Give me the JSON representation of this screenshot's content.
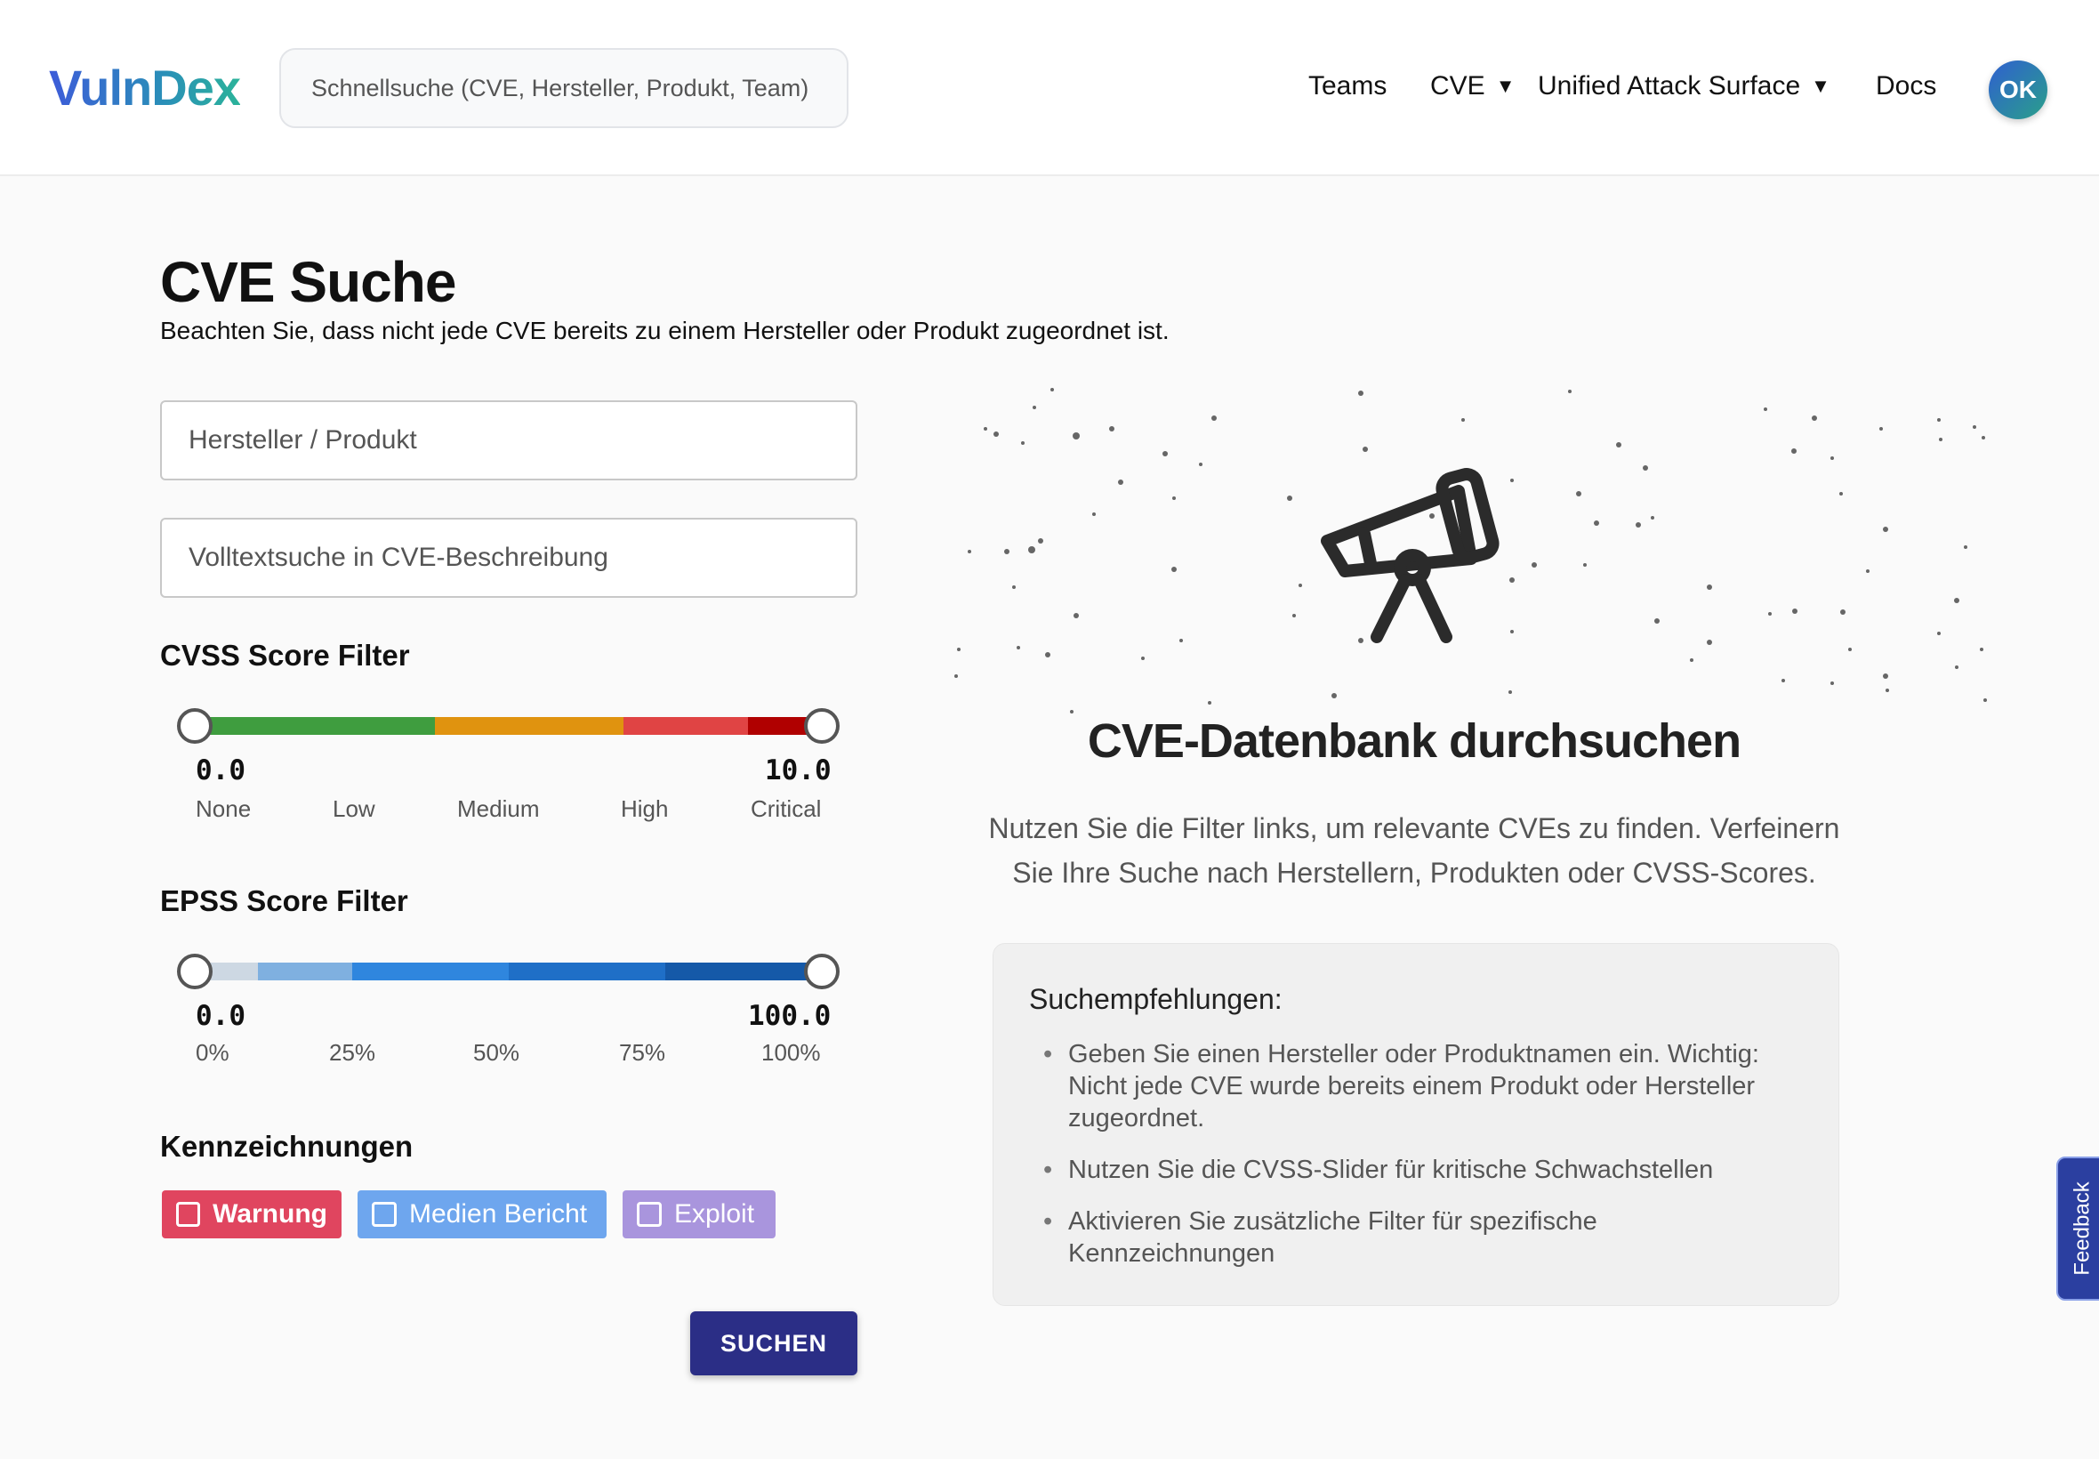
{
  "header": {
    "logo": "VulnDex",
    "search_placeholder": "Schnellsuche (CVE, Hersteller, Produkt, Team)",
    "nav": {
      "teams": "Teams",
      "cve": "CVE",
      "uas": "Unified Attack Surface",
      "docs": "Docs"
    },
    "avatar_initials": "OK"
  },
  "page": {
    "title": "CVE Suche",
    "subtitle": "Beachten Sie, dass nicht jede CVE bereits zu einem Hersteller oder Produkt zugeordnet ist."
  },
  "filters": {
    "vendor_placeholder": "Hersteller / Produkt",
    "fulltext_placeholder": "Volltextsuche in CVE-Beschreibung",
    "cvss": {
      "label": "CVSS Score Filter",
      "min": "0.0",
      "max": "10.0",
      "min_value": 0.0,
      "max_value": 10.0,
      "ticks": [
        "None",
        "Low",
        "Medium",
        "High",
        "Critical"
      ],
      "colors": [
        "#3f9d3f",
        "#e0930f",
        "#e04444",
        "#b00000"
      ]
    },
    "epss": {
      "label": "EPSS Score Filter",
      "min": "0.0",
      "max": "100.0",
      "min_value": 0.0,
      "max_value": 100.0,
      "ticks": [
        "0%",
        "25%",
        "50%",
        "75%",
        "100%"
      ],
      "colors": [
        "#cdd8e3",
        "#7fb0e0",
        "#2f86de",
        "#1f6fc7",
        "#1559a8"
      ]
    },
    "tags_label": "Kennzeichnungen",
    "tags": [
      {
        "label": "Warnung",
        "color": "#e0455f",
        "checked": false
      },
      {
        "label": "Medien Bericht",
        "color": "#6ea6ee",
        "checked": false
      },
      {
        "label": "Exploit",
        "color": "#a995dd",
        "checked": false
      }
    ],
    "submit_label": "SUCHEN"
  },
  "hero": {
    "icon": "telescope-icon",
    "title": "CVE-Datenbank durchsuchen",
    "text": "Nutzen Sie die Filter links, um relevante CVEs zu finden. Verfeinern Sie Ihre Suche nach Herstellern, Produkten oder CVSS-Scores."
  },
  "tips": {
    "title": "Suchempfehlungen:",
    "items": [
      "Geben Sie einen Hersteller oder Produktnamen ein. Wichtig: Nicht jede CVE wurde bereits einem Produkt oder Hersteller zugeordnet.",
      "Nutzen Sie die CVSS-Slider für kritische Schwachstellen",
      "Aktivieren Sie zusätzliche Filter für spezifische Kennzeichnungen"
    ]
  },
  "feedback_label": "Feedback"
}
